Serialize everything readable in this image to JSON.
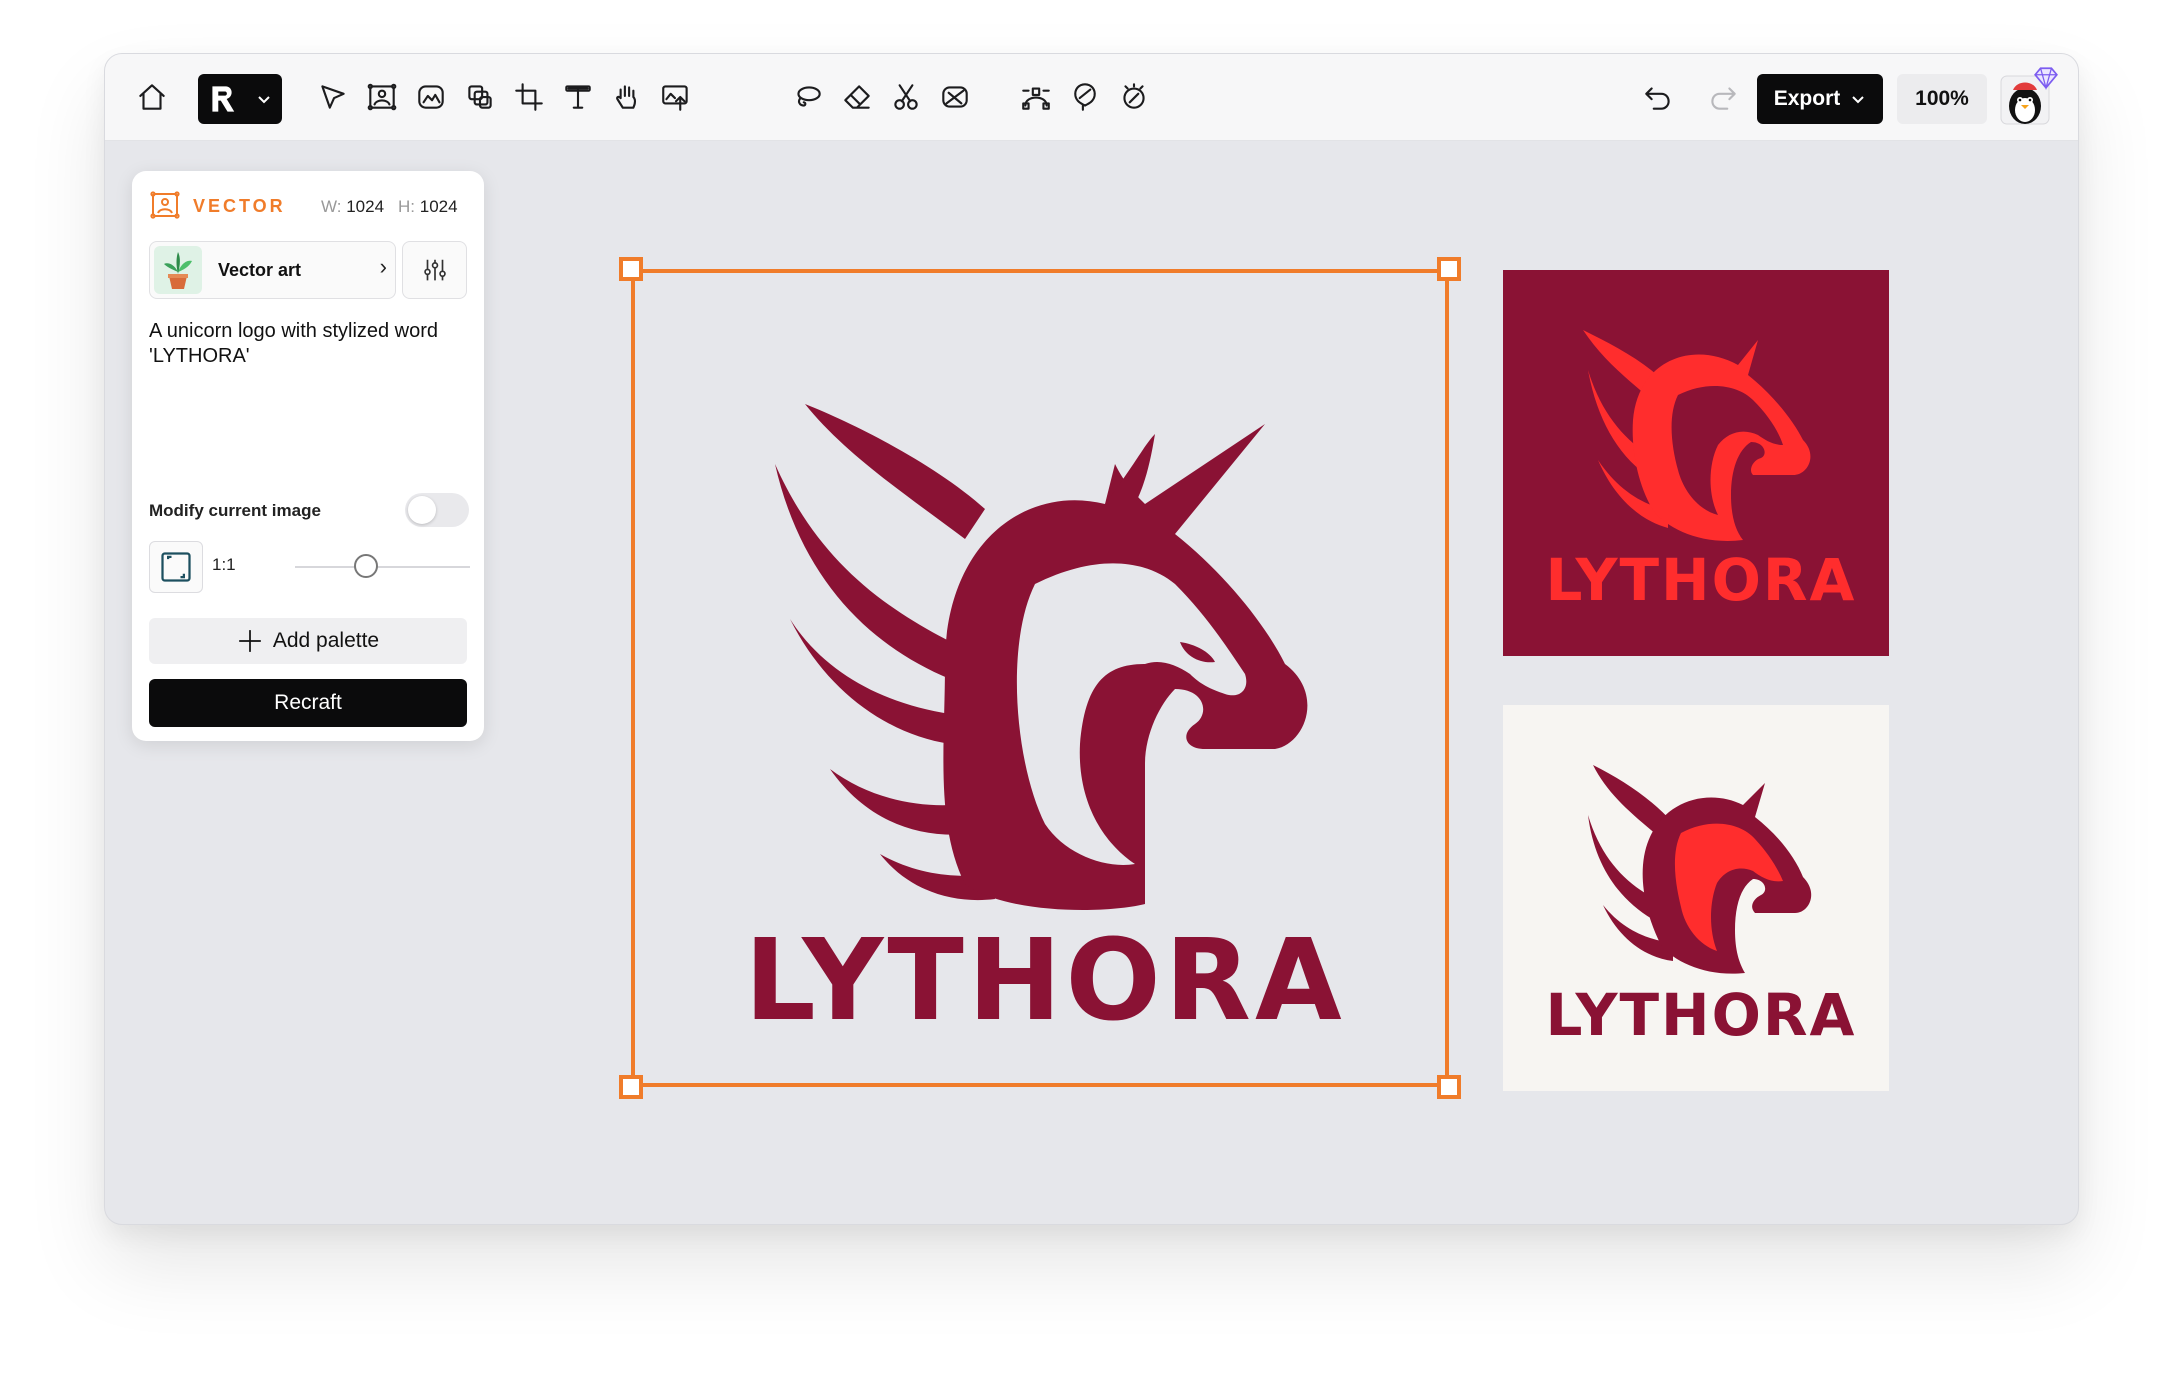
{
  "toolbar": {
    "export_label": "Export",
    "zoom_level": "100%"
  },
  "panel": {
    "type_label": "VECTOR",
    "width_label": "W:",
    "width_value": "1024",
    "height_label": "H:",
    "height_value": "1024",
    "style_label": "Vector art",
    "prompt_text": "A unicorn logo with stylized word 'LYTHORA'",
    "modify_label": "Modify current image",
    "ratio_label": "1:1",
    "add_palette_label": "Add palette",
    "recraft_label": "Recraft"
  },
  "canvas": {
    "logo_word": "LYTHORA",
    "colors": {
      "primary": "#8a1234",
      "accent": "#ff2d2d",
      "selection": "#f07c2a",
      "light_bg": "#f7f5f2"
    }
  },
  "icons": [
    "home-icon",
    "brand-logo-icon",
    "chevron-down-icon",
    "pointer-icon",
    "frame-image-icon",
    "image-icon",
    "layers-icon",
    "crop-icon",
    "text-icon",
    "hand-icon",
    "upscale-icon",
    "lasso-icon",
    "eraser-icon",
    "scissors-icon",
    "remove-bg-icon",
    "vectorize-icon",
    "mockup-icon",
    "magic-icon",
    "undo-icon",
    "redo-icon"
  ]
}
